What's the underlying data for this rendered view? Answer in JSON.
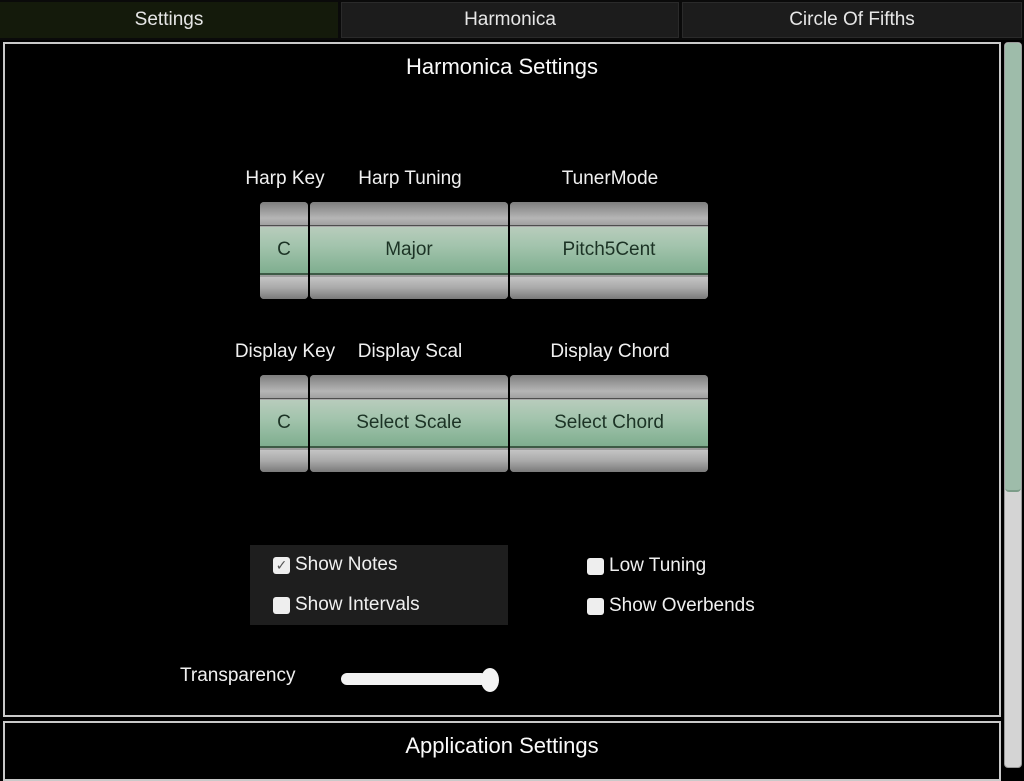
{
  "tabs": [
    {
      "label": "Settings",
      "active": true
    },
    {
      "label": "Harmonica",
      "active": false
    },
    {
      "label": "Circle Of Fifths",
      "active": false
    }
  ],
  "harmonica_settings": {
    "title": "Harmonica Settings",
    "row1": {
      "labels": {
        "harp_key": "Harp Key",
        "harp_tuning": "Harp Tuning",
        "tuner_mode": "TunerMode"
      },
      "values": {
        "harp_key": "C",
        "harp_tuning": "Major",
        "tuner_mode": "Pitch5Cent"
      }
    },
    "row2": {
      "labels": {
        "display_key": "Display Key",
        "display_scale": "Display Scal",
        "display_chord": "Display Chord"
      },
      "values": {
        "display_key": "C",
        "display_scale": "Select Scale",
        "display_chord": "Select Chord"
      }
    },
    "checkboxes": {
      "show_notes": {
        "label": "Show Notes",
        "checked": true,
        "mark": "✓"
      },
      "show_intervals": {
        "label": "Show Intervals",
        "checked": false,
        "mark": ""
      },
      "low_tuning": {
        "label": "Low Tuning",
        "checked": false,
        "mark": ""
      },
      "show_overbends": {
        "label": "Show Overbends",
        "checked": false,
        "mark": ""
      }
    },
    "transparency": {
      "label": "Transparency",
      "value_fraction": 1.0
    }
  },
  "application_settings": {
    "title": "Application Settings"
  },
  "scrollbar": {
    "position_fraction": 0.0,
    "visible_fraction": 0.62
  },
  "colors": {
    "picker_accent": "#a3c4ad",
    "active_tab": "#141a0b",
    "scroll_thumb": "#9ebcaa"
  }
}
